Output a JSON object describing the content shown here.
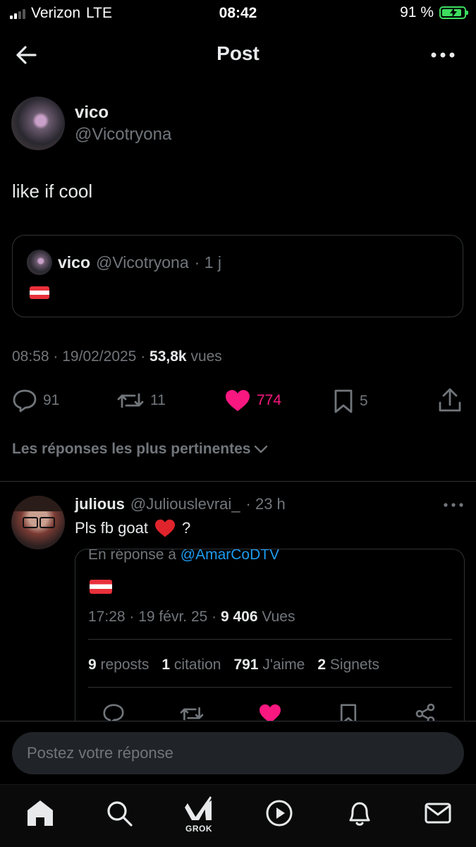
{
  "status_bar": {
    "carrier": "Verizon",
    "network": "LTE",
    "time": "08:42",
    "battery": "91 %",
    "battery_level": 0.91,
    "accent": "#3ddc5f"
  },
  "header": {
    "title": "Post"
  },
  "post": {
    "author_name": "vico",
    "author_handle": "@Vicotryona",
    "text": "like if cool",
    "quote": {
      "author_name": "vico",
      "author_handle": "@Vicotryona",
      "age": "· 1 j"
    },
    "meta": {
      "time": "08:58",
      "date": "19/02/2025",
      "views": "53,8k",
      "views_label": "vues",
      "sep": "·"
    },
    "actions": {
      "replies": "91",
      "reposts": "11",
      "likes": "774",
      "bookmarks": "5",
      "like_color": "#f91880"
    }
  },
  "replies_sort_label": "Les réponses les plus pertinentes",
  "reply": {
    "author_name": "julious",
    "author_handle": "@Juliouslevrai_",
    "age": "· 23 h",
    "text_before": "Pls fb goat",
    "text_after": "?",
    "embed": {
      "reply_to_prefix": "En réponse à",
      "reply_to_handle": "@AmarCoDTV",
      "time": "17:28",
      "date": "19 févr. 25",
      "views": "9 406",
      "views_label": "Vues",
      "stats": [
        {
          "count": "9",
          "label": "reposts"
        },
        {
          "count": "1",
          "label": "citation"
        },
        {
          "count": "791",
          "label": "J'aime"
        },
        {
          "count": "2",
          "label": "Signets"
        }
      ]
    }
  },
  "composer": {
    "placeholder": "Postez votre réponse"
  },
  "tabbar": {
    "grok_label": "GROK"
  }
}
